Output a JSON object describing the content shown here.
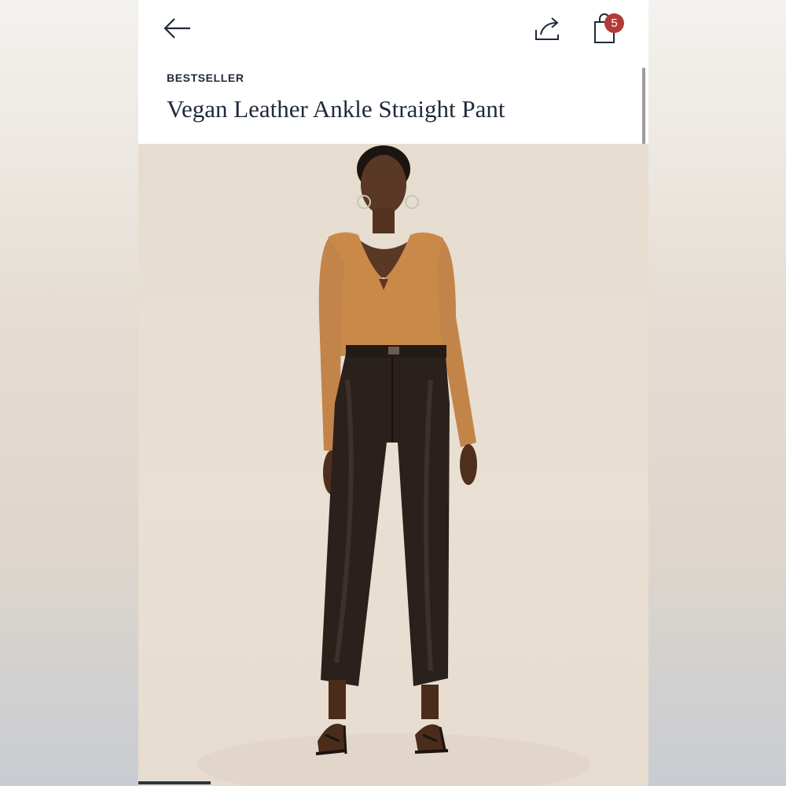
{
  "header": {
    "back_icon": "arrow-left-icon",
    "share_icon": "share-icon",
    "bag_icon": "shopping-bag-icon",
    "bag_count": "5"
  },
  "product": {
    "badge": "BESTSELLER",
    "title": "Vegan Leather Ankle Straight Pant",
    "image_position": "1 of carousel"
  },
  "colors": {
    "text_primary": "#1f2a3a",
    "badge_red": "#b23a37",
    "photo_background": "#e6dccf",
    "top_color": "#c98a49",
    "pant_color": "#2a211c"
  }
}
